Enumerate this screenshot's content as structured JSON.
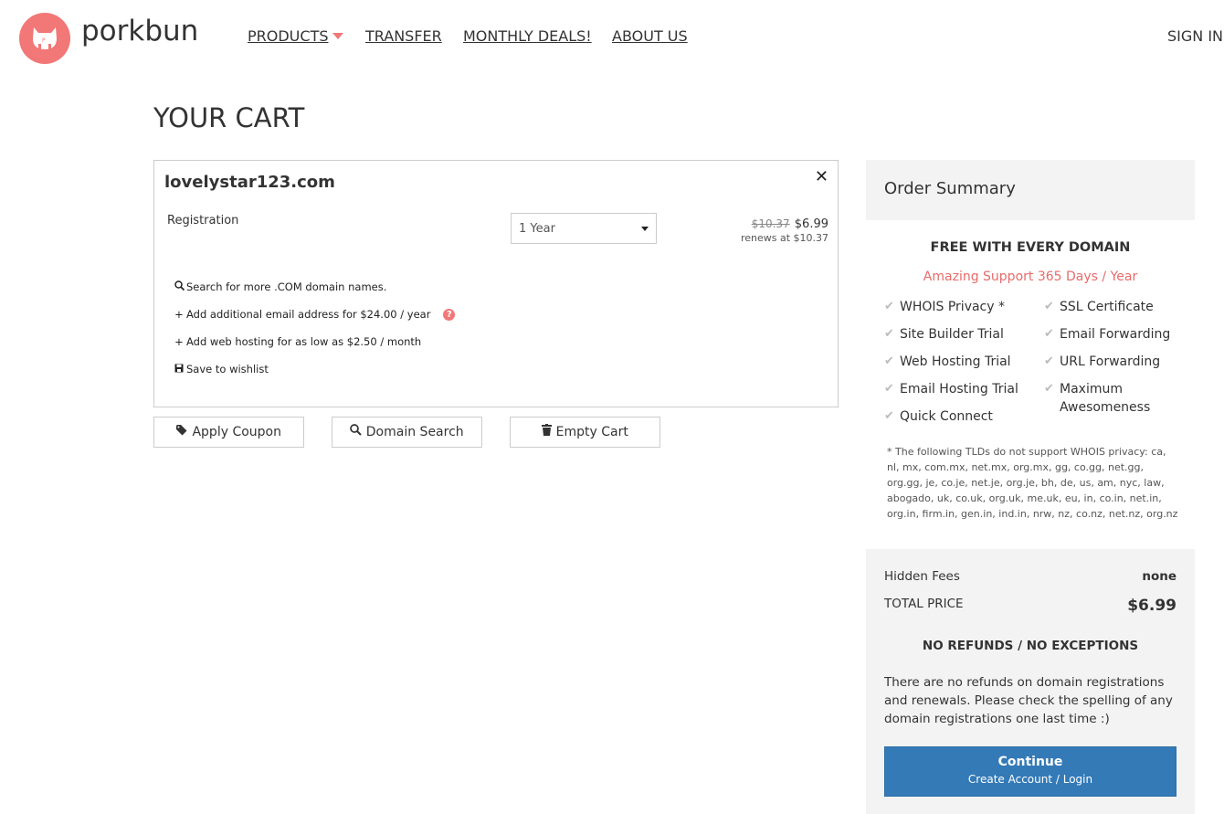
{
  "header": {
    "logo_text": "porkbun",
    "nav": {
      "products": "PRODUCTS",
      "transfer": "TRANSFER",
      "monthly_deals": "MONTHLY DEALS!",
      "about_us": "ABOUT US"
    },
    "sign_in": "SIGN IN"
  },
  "page_title": "YOUR CART",
  "cart_item": {
    "domain": "lovelystar123.com",
    "close_glyph": "✕",
    "registration_label": "Registration",
    "term_selected": "1 Year",
    "old_price": "$10.37",
    "new_price": "$6.99",
    "renews": "renews at $10.37",
    "options": {
      "search_more": "Search for more .COM domain names.",
      "add_email": "Add additional email address for $24.00 / year",
      "add_hosting": "Add web hosting for as low as $2.50 / month",
      "save_wishlist": "Save to wishlist"
    },
    "help_glyph": "?"
  },
  "buttons": {
    "apply_coupon": "Apply Coupon",
    "domain_search": "Domain Search",
    "empty_cart": "Empty Cart"
  },
  "summary": {
    "title": "Order Summary",
    "free_title": "FREE WITH EVERY DOMAIN",
    "support": "Amazing Support 365 Days / Year",
    "features_left": [
      "WHOIS Privacy *",
      "Site Builder Trial",
      "Web Hosting Trial",
      "Email Hosting Trial",
      "Quick Connect"
    ],
    "features_right": [
      "SSL Certificate",
      "Email Forwarding",
      "URL Forwarding",
      "Maximum Awesomeness"
    ],
    "tld_note": "* The following TLDs do not support WHOIS privacy: ca, nl, mx, com.mx, net.mx, org.mx, gg, co.gg, net.gg, org.gg, je, co.je, net.je, org.je, bh, de, us, am, nyc, law, abogado, uk, co.uk, org.uk, me.uk, eu, in, co.in, net.in, org.in, firm.in, gen.in, ind.in, nrw, nz, co.nz, net.nz, org.nz",
    "hidden_fees_label": "Hidden Fees",
    "hidden_fees_value": "none",
    "total_label": "TOTAL PRICE",
    "total_value": "$6.99",
    "no_refunds": "NO REFUNDS / NO EXCEPTIONS",
    "refund_text": "There are no refunds on domain registrations and renewals. Please check the spelling of any domain registrations one last time :)",
    "continue_label": "Continue",
    "continue_sub": "Create Account / Login"
  },
  "colors": {
    "brand_pink": "#f27777",
    "primary_blue": "#337ab7",
    "panel_grey": "#f3f3f3"
  },
  "icons": [
    "pig-logo-icon",
    "caret-down-icon",
    "close-icon",
    "search-icon",
    "plus-icon",
    "save-icon",
    "help-icon",
    "tag-icon",
    "trash-icon",
    "check-icon"
  ]
}
